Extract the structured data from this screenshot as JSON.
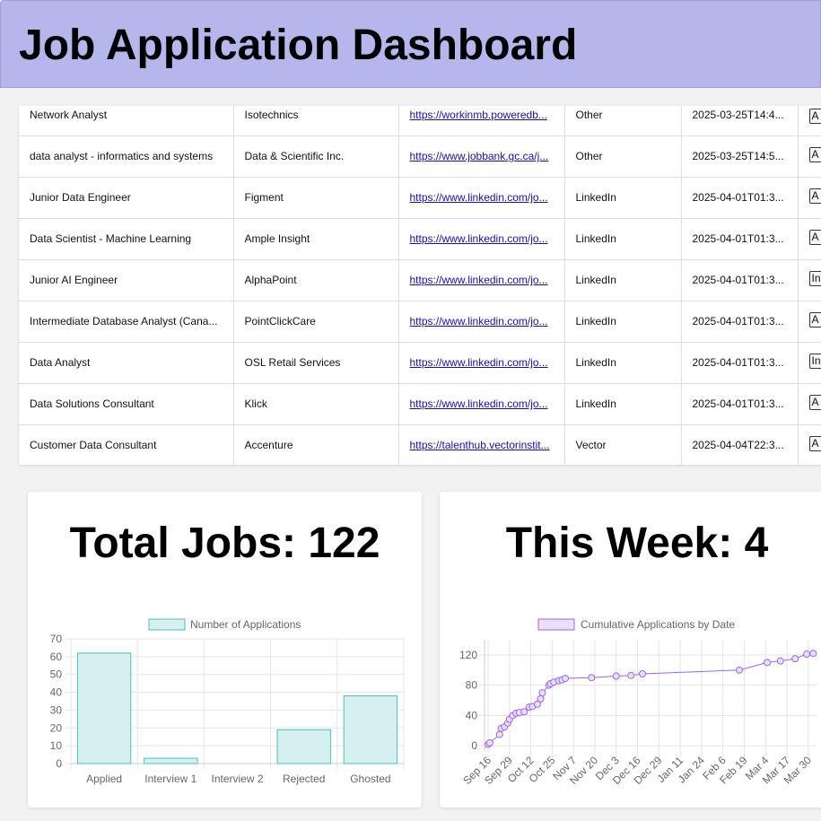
{
  "header": {
    "title": "Job Application Dashboard"
  },
  "table": {
    "rows": [
      {
        "title": "Network Analyst",
        "company": "Isotechnics",
        "link": "https://workinmb.poweredb...",
        "source": "Other",
        "date": "2025-03-25T14:4...",
        "status": "A"
      },
      {
        "title": "data analyst - informatics and systems",
        "company": "Data & Scientific Inc.",
        "link": "https://www.jobbank.gc.ca/j...",
        "source": "Other",
        "date": "2025-03-25T14:5...",
        "status": "A"
      },
      {
        "title": "Junior Data Engineer",
        "company": "Figment",
        "link": "https://www.linkedin.com/jo...",
        "source": "LinkedIn",
        "date": "2025-04-01T01:3...",
        "status": "A"
      },
      {
        "title": "Data Scientist - Machine Learning",
        "company": "Ample Insight",
        "link": "https://www.linkedin.com/jo...",
        "source": "LinkedIn",
        "date": "2025-04-01T01:3...",
        "status": "A"
      },
      {
        "title": "Junior AI Engineer",
        "company": "AlphaPoint",
        "link": "https://www.linkedin.com/jo...",
        "source": "LinkedIn",
        "date": "2025-04-01T01:3...",
        "status": "In"
      },
      {
        "title": "Intermediate Database Analyst (Cana...",
        "company": "PointClickCare",
        "link": "https://www.linkedin.com/jo...",
        "source": "LinkedIn",
        "date": "2025-04-01T01:3...",
        "status": "A"
      },
      {
        "title": "Data Analyst",
        "company": "OSL Retail Services",
        "link": "https://www.linkedin.com/jo...",
        "source": "LinkedIn",
        "date": "2025-04-01T01:3...",
        "status": "In"
      },
      {
        "title": "Data Solutions Consultant",
        "company": "Klick",
        "link": "https://www.linkedin.com/jo...",
        "source": "LinkedIn",
        "date": "2025-04-01T01:3...",
        "status": "A"
      },
      {
        "title": "Customer Data Consultant",
        "company": "Accenture",
        "link": "https://talenthub.vectorinstit...",
        "source": "Vector",
        "date": "2025-04-04T22:3...",
        "status": "A"
      }
    ]
  },
  "total_card": {
    "title": "Total Jobs: 122"
  },
  "week_card": {
    "title": "This Week: 4"
  },
  "chart_data": [
    {
      "type": "bar",
      "legend": "Number of Applications",
      "categories": [
        "Applied",
        "Interview 1",
        "Interview 2",
        "Rejected",
        "Ghosted"
      ],
      "values": [
        62,
        3,
        0,
        19,
        38
      ],
      "ylim": [
        0,
        70
      ],
      "yticks": [
        0,
        10,
        20,
        30,
        40,
        50,
        60,
        70
      ],
      "grid": true,
      "colors": {
        "fill": "#d6eff0",
        "stroke": "#4bc0c0"
      }
    },
    {
      "type": "line",
      "legend": "Cumulative Applications by Date",
      "x_tick_labels": [
        "Sep 16",
        "Sep 29",
        "Oct 12",
        "Oct 25",
        "Nov 7",
        "Nov 20",
        "Dec 3",
        "Dec 16",
        "Dec 29",
        "Jan 11",
        "Jan 24",
        "Feb 6",
        "Feb 19",
        "Mar 4",
        "Mar 17",
        "Mar 30"
      ],
      "x_tick_positions": [
        0,
        13,
        26,
        39,
        52,
        65,
        78,
        91,
        104,
        117,
        130,
        143,
        156,
        169,
        182,
        195
      ],
      "points": [
        [
          0,
          2
        ],
        [
          1,
          4
        ],
        [
          7,
          15
        ],
        [
          8,
          23
        ],
        [
          10,
          25
        ],
        [
          12,
          30
        ],
        [
          13,
          35
        ],
        [
          15,
          40
        ],
        [
          17,
          43
        ],
        [
          19,
          44
        ],
        [
          22,
          45
        ],
        [
          25,
          51
        ],
        [
          27,
          52
        ],
        [
          30,
          55
        ],
        [
          32,
          62
        ],
        [
          33,
          70
        ],
        [
          37,
          80
        ],
        [
          38,
          82
        ],
        [
          40,
          84
        ],
        [
          43,
          86
        ],
        [
          45,
          87
        ],
        [
          47,
          89
        ],
        [
          63,
          90
        ],
        [
          78,
          92
        ],
        [
          87,
          93
        ],
        [
          94,
          95
        ],
        [
          153,
          100
        ],
        [
          170,
          110
        ],
        [
          178,
          112
        ],
        [
          187,
          115
        ],
        [
          194,
          121
        ],
        [
          198,
          122
        ]
      ],
      "yticks": [
        0,
        40,
        80,
        120
      ],
      "ylim": [
        -8,
        140
      ],
      "grid": true,
      "colors": {
        "fill": "#ecdffb",
        "stroke": "#9966ff"
      }
    }
  ]
}
